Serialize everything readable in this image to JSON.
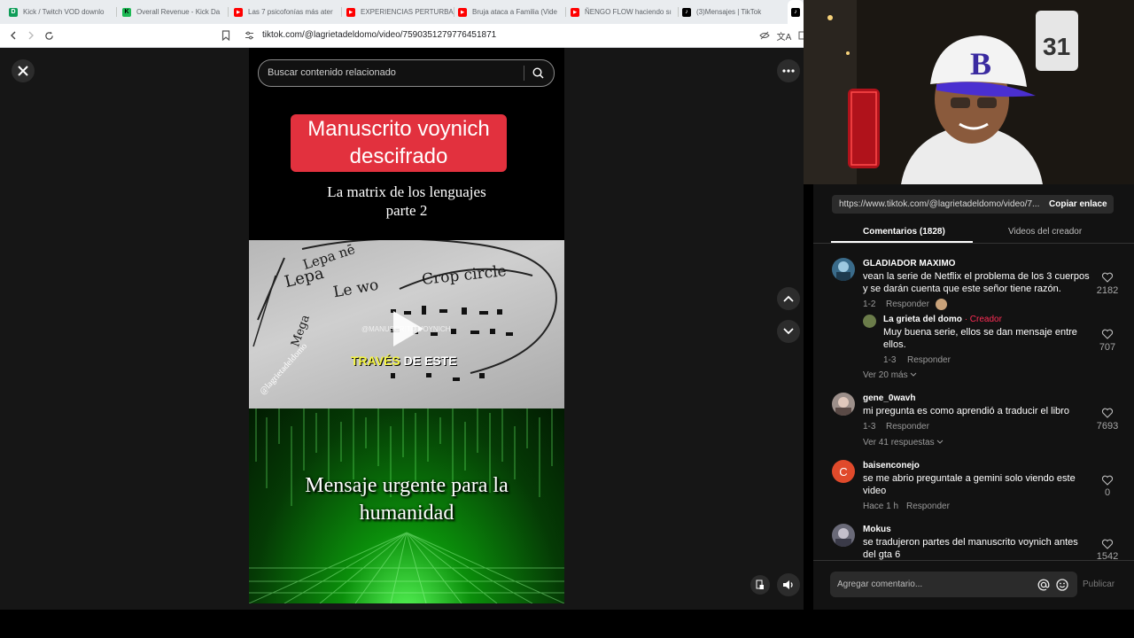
{
  "browser": {
    "tabs": [
      {
        "label": "Kick / Twitch VOD downlo",
        "color": "#0f9d58",
        "glyph": "D"
      },
      {
        "label": "Overall Revenue - Kick Da",
        "color": "#1db954",
        "glyph": "K"
      },
      {
        "label": "Las 7 psicofonías más ater",
        "color": "#ff0000",
        "glyph": "▶"
      },
      {
        "label": "EXPERIENCIAS PERTURBA",
        "color": "#ff0000",
        "glyph": "▶"
      },
      {
        "label": "Bruja ataca a Familia (Vide",
        "color": "#ff0000",
        "glyph": "▶"
      },
      {
        "label": "ÑENGO FLOW haciendo sı",
        "color": "#ff0000",
        "glyph": "▶"
      },
      {
        "label": "(3)Mensajes | TikTok",
        "color": "#000000",
        "glyph": "♪"
      }
    ],
    "url": "tiktok.com/@lagrietadeldomo/video/7590351279776451871"
  },
  "player": {
    "search_placeholder": "Buscar contenido relacionado",
    "banner_line1": "Manuscrito voynich",
    "banner_line2": "descifrado",
    "subtitle_line1": "La matrix de los lenguajes",
    "subtitle_line2": "parte 2",
    "sketch_words": [
      "Lepa nē",
      "Lepa",
      "Le wo",
      "Mega",
      "Crop circle",
      "@lagrietadeldomo",
      "@MANUSCRITO VOYNICH"
    ],
    "caption_yellow": "TRAVÉS",
    "caption_white": "DE ESTE",
    "green_line1": "Mensaje urgente para la",
    "green_line2": "humanidad"
  },
  "panel": {
    "link": "https://www.tiktok.com/@lagrietadeldomo/video/7...",
    "copy_button": "Copiar enlace",
    "tab_comments": "Comentarios (1828)",
    "tab_creator": "Videos del creador",
    "comments": [
      {
        "name": "GLADIADOR MAXIMO",
        "text_l1": "vean la serie de Netflix el problema de los 3 cuerpos",
        "text_l2": "y se darán cuenta que este señor tiene razón.",
        "date": "1-2",
        "reply": "Responder",
        "likes": "2182"
      },
      {
        "name": "La grieta del domo",
        "creator_tag": "· Creador",
        "text_l1": "Muy buena serie, ellos se dan mensaje entre",
        "text_l2": "ellos.",
        "date": "1-3",
        "reply": "Responder",
        "likes": "707"
      },
      {
        "name": "gene_0wavh",
        "text_l1": "mi pregunta es como aprendió a traducir el libro",
        "date": "1-3",
        "reply": "Responder",
        "likes": "7693"
      },
      {
        "name": "baisenconejo",
        "avatar_letter": "C",
        "text_l1": "se me abrio preguntale a gemini solo viendo este",
        "text_l2": "video",
        "date": "Hace 1 h",
        "reply": "Responder",
        "likes": "0"
      },
      {
        "name": "Mokus",
        "text_l1": "se tradujeron partes del manuscrito voynich antes",
        "text_l2": "del gta 6",
        "likes": "1542"
      }
    ],
    "view_more_1": "Ver 20 más",
    "view_more_2": "Ver 41 respuestas",
    "composer_placeholder": "Agregar comentario...",
    "publish": "Publicar"
  },
  "colors": {
    "creator_red": "#fe2c55",
    "banner_red": "#e2313e",
    "caption_yellow": "#f5f542"
  }
}
